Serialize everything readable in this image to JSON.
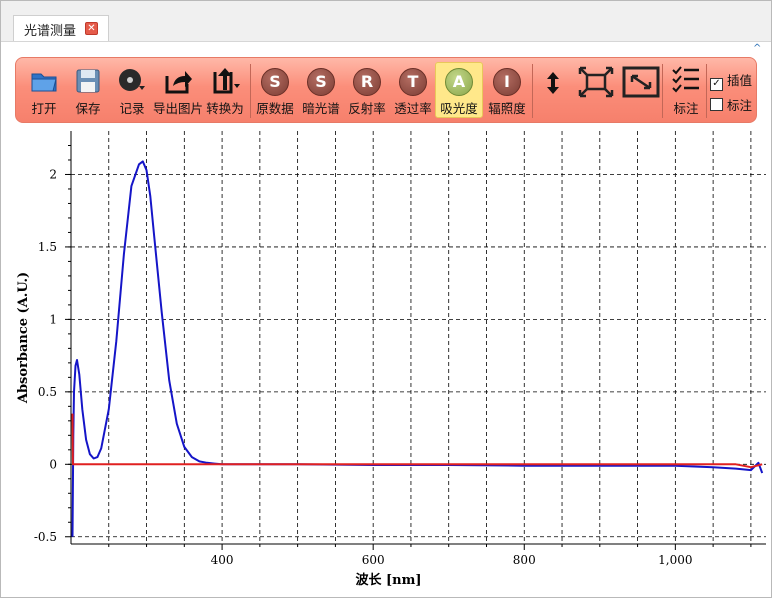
{
  "tab": {
    "title": "光谱测量",
    "close_glyph": "✕"
  },
  "ribbon": {
    "collapse_glyph": "^",
    "buttons": [
      {
        "id": "open",
        "label": "打开",
        "icon": "folder-icon"
      },
      {
        "id": "save",
        "label": "保存",
        "icon": "floppy-disk-icon"
      },
      {
        "id": "record",
        "label": "记录",
        "icon": "record-disc-icon"
      },
      {
        "id": "export",
        "label": "导出图片",
        "icon": "export-arrow-icon"
      },
      {
        "id": "convert",
        "label": "转换为",
        "icon": "upload-arrow-icon"
      },
      {
        "id": "raw",
        "label": "原数据",
        "glyph": "S"
      },
      {
        "id": "dark",
        "label": "暗光谱",
        "glyph": "S"
      },
      {
        "id": "reflect",
        "label": "反射率",
        "glyph": "R"
      },
      {
        "id": "transmit",
        "label": "透过率",
        "glyph": "T"
      },
      {
        "id": "absorb",
        "label": "吸光度",
        "glyph": "A"
      },
      {
        "id": "irradiance",
        "label": "辐照度",
        "glyph": "I"
      }
    ],
    "view_tools": [
      "vertical-scale-icon",
      "fit-view-icon",
      "zoom-box-icon"
    ],
    "annotate_label": "标注",
    "checkboxes": [
      {
        "label": "插值",
        "checked": true
      },
      {
        "label": "标注",
        "checked": false
      }
    ]
  },
  "chart_data": {
    "type": "line",
    "xlabel": "波长 [nm]",
    "ylabel": "Absorbance (A.U.)",
    "xlim": [
      200,
      1120
    ],
    "ylim": [
      -0.55,
      2.3
    ],
    "x_ticks": [
      400,
      600,
      800,
      1000
    ],
    "x_tick_labels": [
      "400",
      "600",
      "800",
      "1,000"
    ],
    "y_ticks": [
      -0.5,
      0,
      0.5,
      1,
      1.5,
      2
    ],
    "y_tick_labels": [
      "-0.5",
      "0",
      "0.5",
      "1",
      "1.5",
      "2"
    ],
    "grid": true,
    "series": [
      {
        "color": "#1515c8",
        "x": [
          202,
          203,
          204,
          206,
          208,
          211,
          215,
          220,
          225,
          230,
          235,
          240,
          250,
          260,
          270,
          280,
          290,
          295,
          300,
          305,
          310,
          320,
          330,
          340,
          350,
          360,
          370,
          380,
          390,
          400,
          500,
          600,
          700,
          800,
          900,
          950,
          1000,
          1050,
          1080,
          1100,
          1110,
          1115
        ],
        "y": [
          -0.5,
          0.2,
          0.5,
          0.68,
          0.72,
          0.62,
          0.38,
          0.17,
          0.07,
          0.04,
          0.05,
          0.11,
          0.38,
          0.85,
          1.45,
          1.92,
          2.07,
          2.09,
          2.03,
          1.85,
          1.58,
          1.05,
          0.58,
          0.28,
          0.12,
          0.05,
          0.02,
          0.01,
          0.005,
          0.0,
          0.0,
          -0.005,
          -0.005,
          -0.01,
          -0.01,
          -0.01,
          -0.01,
          -0.02,
          -0.03,
          -0.04,
          0.01,
          -0.06
        ]
      },
      {
        "color": "#e02020",
        "x": [
          202,
          202.5,
          203,
          400,
          600,
          800,
          1000,
          1060,
          1080,
          1100,
          1115
        ],
        "y": [
          0.35,
          0.0,
          0.0,
          0.0,
          0.0,
          0.0,
          0.0,
          0.0,
          0.0,
          -0.02,
          0.0
        ]
      }
    ]
  }
}
